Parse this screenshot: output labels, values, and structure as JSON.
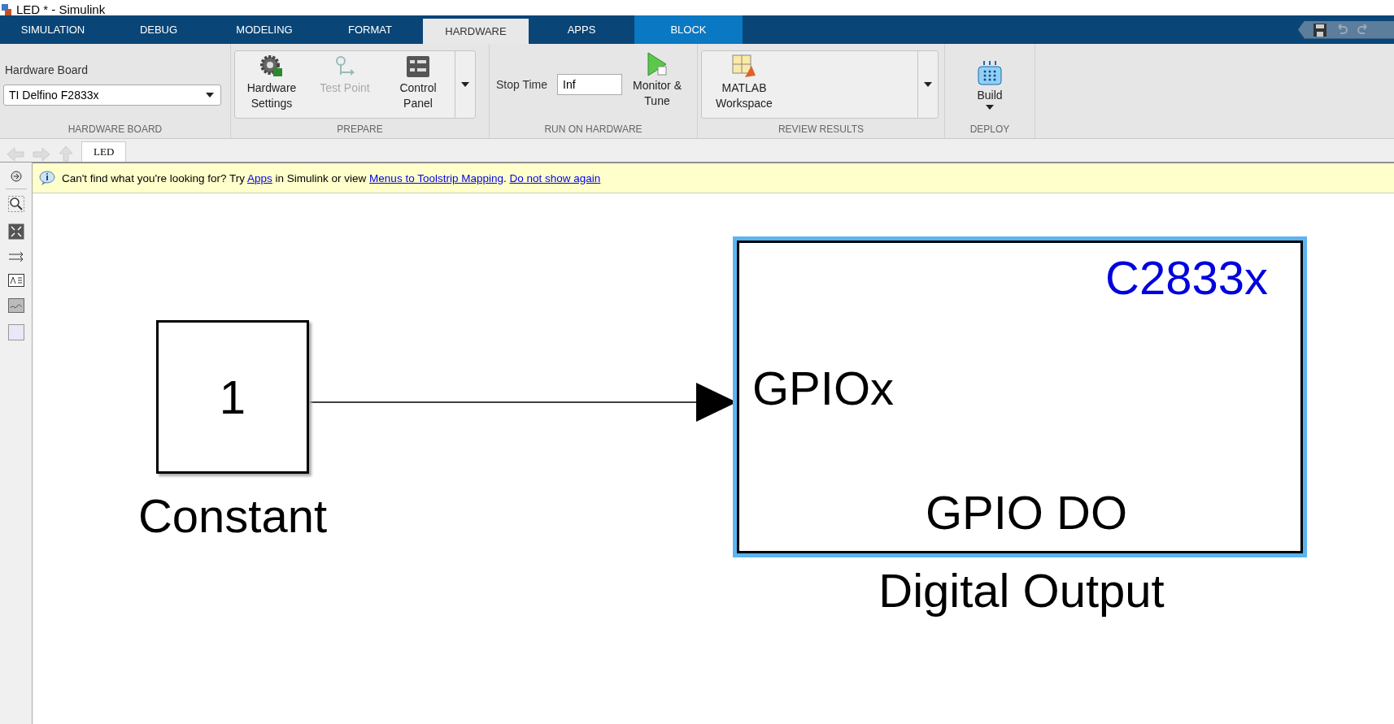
{
  "window": {
    "title": "LED * - Simulink"
  },
  "tabs": [
    {
      "label": "SIMULATION",
      "selected": false,
      "contextual": false
    },
    {
      "label": "DEBUG",
      "selected": false,
      "contextual": false
    },
    {
      "label": "MODELING",
      "selected": false,
      "contextual": false
    },
    {
      "label": "FORMAT",
      "selected": false,
      "contextual": false
    },
    {
      "label": "HARDWARE",
      "selected": true,
      "contextual": false
    },
    {
      "label": "APPS",
      "selected": false,
      "contextual": false
    },
    {
      "label": "BLOCK",
      "selected": false,
      "contextual": true
    }
  ],
  "ribbon": {
    "hardware_board": {
      "label": "Hardware Board",
      "value": "TI Delfino F2833x",
      "section": "HARDWARE BOARD"
    },
    "prepare": {
      "section": "PREPARE",
      "buttons": [
        {
          "kind": "settings",
          "label": "Hardware Settings",
          "disabled": false
        },
        {
          "kind": "testpoint",
          "label": "Test Point",
          "disabled": true
        },
        {
          "kind": "panel",
          "label": "Control Panel",
          "disabled": false
        }
      ]
    },
    "run": {
      "section": "RUN ON HARDWARE",
      "stop_time_label": "Stop Time",
      "stop_time": "Inf",
      "monitor": "Monitor & Tune"
    },
    "review": {
      "section": "REVIEW RESULTS",
      "button": "MATLAB Workspace"
    },
    "deploy": {
      "section": "DEPLOY",
      "button": "Build"
    }
  },
  "breadcrumb": {
    "tab": "LED"
  },
  "info_bar": {
    "segments": [
      {
        "kind": "text",
        "text": "Can't find what you're looking for? Try "
      },
      {
        "kind": "link",
        "text": "Apps"
      },
      {
        "kind": "text",
        "text": " in Simulink or view "
      },
      {
        "kind": "link",
        "text": "Menus to Toolstrip Mapping"
      },
      {
        "kind": "text",
        "text": ". "
      },
      {
        "kind": "link",
        "text": "Do not show again"
      }
    ]
  },
  "diagram": {
    "blocks": [
      {
        "kind": "constant",
        "value": "1",
        "name": "Constant",
        "selected": false
      },
      {
        "kind": "gpio_do",
        "target": "C2833x",
        "port": "GPIOx",
        "body": "GPIO DO",
        "name": "Digital Output",
        "selected": true
      }
    ]
  }
}
